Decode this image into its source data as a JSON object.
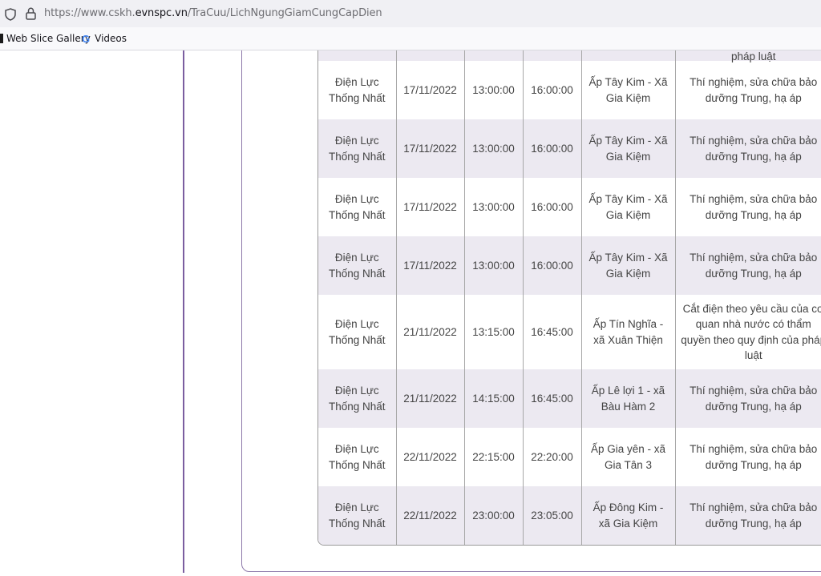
{
  "browser": {
    "url_prefix": "https://www.cskh.",
    "url_host": "evnspc.vn",
    "url_path": "/TraCuu/LichNgungGiamCungCapDien",
    "bookmarks": [
      {
        "label": "Web Slice Gallery",
        "icon": "web-slice-icon"
      },
      {
        "label": "Videos",
        "icon": "google-icon"
      }
    ]
  },
  "table": {
    "partial_row_text": "pháp luật",
    "rows": [
      {
        "unit": "Điện Lực Thống Nhất",
        "date": "17/11/2022",
        "start": "13:00:00",
        "end": "16:00:00",
        "area": "Ấp Tây Kim - Xã Gia Kiệm",
        "reason": "Thí nghiệm, sửa chữa bảo dưỡng Trung, hạ áp"
      },
      {
        "unit": "Điện Lực Thống Nhất",
        "date": "17/11/2022",
        "start": "13:00:00",
        "end": "16:00:00",
        "area": "Ấp Tây Kim - Xã Gia Kiệm",
        "reason": "Thí nghiệm, sửa chữa bảo dưỡng Trung, hạ áp"
      },
      {
        "unit": "Điện Lực Thống Nhất",
        "date": "17/11/2022",
        "start": "13:00:00",
        "end": "16:00:00",
        "area": "Ấp Tây Kim - Xã Gia Kiệm",
        "reason": "Thí nghiệm, sửa chữa bảo dưỡng Trung, hạ áp"
      },
      {
        "unit": "Điện Lực Thống Nhất",
        "date": "17/11/2022",
        "start": "13:00:00",
        "end": "16:00:00",
        "area": "Ấp Tây Kim - Xã Gia Kiệm",
        "reason": "Thí nghiệm, sửa chữa bảo dưỡng Trung, hạ áp"
      },
      {
        "unit": "Điện Lực Thống Nhất",
        "date": "21/11/2022",
        "start": "13:15:00",
        "end": "16:45:00",
        "area": "Ấp Tín Nghĩa - xã Xuân Thiện",
        "reason": "Cắt điện theo yêu cầu của cơ quan nhà nước có thẩm quyền theo quy định của pháp luật"
      },
      {
        "unit": "Điện Lực Thống Nhất",
        "date": "21/11/2022",
        "start": "14:15:00",
        "end": "16:45:00",
        "area": "Ấp Lê lợi 1 - xã Bàu Hàm 2",
        "reason": "Thí nghiệm, sửa chữa bảo dưỡng Trung, hạ áp"
      },
      {
        "unit": "Điện Lực Thống Nhất",
        "date": "22/11/2022",
        "start": "22:15:00",
        "end": "22:20:00",
        "area": "Ấp Gia yên - xã Gia Tân 3",
        "reason": "Thí nghiệm, sửa chữa bảo dưỡng Trung, hạ áp"
      },
      {
        "unit": "Điện Lực Thống Nhất",
        "date": "22/11/2022",
        "start": "23:00:00",
        "end": "23:05:00",
        "area": "Ấp Đông Kim - xã Gia Kiệm",
        "reason": "Thí nghiệm, sửa chữa bảo dưỡng Trung, hạ áp"
      }
    ]
  }
}
